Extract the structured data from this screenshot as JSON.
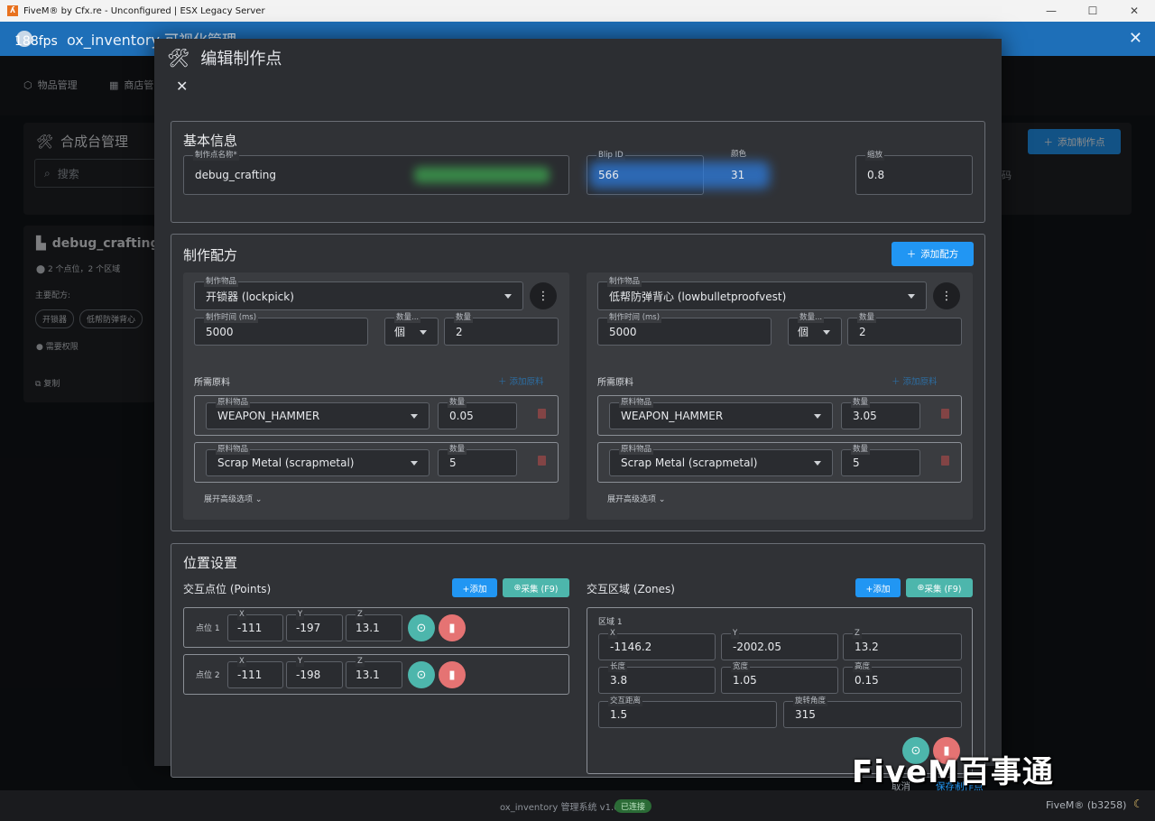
{
  "window": {
    "title": "FiveM® by Cfx.re - Unconfigured | ESX Legacy Server"
  },
  "app": {
    "title": "ox_inventory 可视化管理",
    "fps": "188fps"
  },
  "nav": {
    "items": [
      "物品管理",
      "商店管"
    ]
  },
  "background": {
    "panel_title": "合成台管理",
    "search_placeholder": "搜索",
    "add_button": "添加制作点",
    "hint_text": "码",
    "card": {
      "title": "debug_crafting",
      "meta": "2 个点位，2 个区域",
      "recipes_label": "主要配方:",
      "chips": [
        "开锁器",
        "低帮防弹背心"
      ],
      "permission": "需要权限",
      "copy": "复制"
    }
  },
  "modal": {
    "title": "编辑制作点",
    "basic": {
      "title": "基本信息",
      "name_label": "制作点名称*",
      "name_value": "debug_crafting",
      "blip_label": "Blip ID",
      "blip_value": "566",
      "color_label": "颜色",
      "color_value": "31",
      "scale_label": "缩放",
      "scale_value": "0.8"
    },
    "recipes": {
      "title": "制作配方",
      "add_button": "添加配方",
      "items": [
        {
          "item_label": "制作物品",
          "item_value": "开锁器 (lockpick)",
          "time_label": "制作时间 (ms)",
          "time_value": "5000",
          "unit_label": "数量...",
          "unit_value": "個",
          "count_label": "数量",
          "count_value": "2",
          "materials_label": "所需原料",
          "add_material": "添加原料",
          "materials": [
            {
              "label": "原料物品",
              "item": "WEAPON_HAMMER",
              "qty_label": "数量",
              "qty": "0.05"
            },
            {
              "label": "原料物品",
              "item": "Scrap Metal (scrapmetal)",
              "qty_label": "数量",
              "qty": "5"
            }
          ],
          "advanced": "展开高级选项"
        },
        {
          "item_label": "制作物品",
          "item_value": "低帮防弹背心 (lowbulletproofvest)",
          "time_label": "制作时间 (ms)",
          "time_value": "5000",
          "unit_label": "数量...",
          "unit_value": "個",
          "count_label": "数量",
          "count_value": "2",
          "materials_label": "所需原料",
          "add_material": "添加原料",
          "materials": [
            {
              "label": "原料物品",
              "item": "WEAPON_HAMMER",
              "qty_label": "数量",
              "qty": "3.05"
            },
            {
              "label": "原料物品",
              "item": "Scrap Metal (scrapmetal)",
              "qty_label": "数量",
              "qty": "5"
            }
          ],
          "advanced": "展开高级选项"
        }
      ]
    },
    "location": {
      "title": "位置设置",
      "points_title": "交互点位 (Points)",
      "zones_title": "交互区域 (Zones)",
      "add_button": "+添加",
      "capture_button": "采集 (F9)",
      "points": [
        {
          "label": "点位 1",
          "x": "-111",
          "y": "-197",
          "z": "13.1"
        },
        {
          "label": "点位 2",
          "x": "-111",
          "y": "-198",
          "z": "13.1"
        }
      ],
      "axis_labels": {
        "x": "X",
        "y": "Y",
        "z": "Z"
      },
      "zone": {
        "label": "区域 1",
        "x": "-1146.2",
        "y": "-2002.05",
        "z": "13.2",
        "length_label": "长度",
        "length": "3.8",
        "width_label": "宽度",
        "width": "1.05",
        "height_label": "高度",
        "height": "0.15",
        "distance_label": "交互距离",
        "distance": "1.5",
        "rotation_label": "旋转角度",
        "rotation": "315"
      }
    },
    "footer": {
      "cancel": "取消",
      "save": "保存制作点"
    }
  },
  "statusbar": {
    "text": "ox_inventory 管理系统 v1.0",
    "badge": "已连接",
    "build": "FiveM® (b3258)"
  },
  "watermark": "FiveM百事通",
  "colors": {
    "accent": "#2196f3",
    "teal": "#4db6ac",
    "danger": "#e57373",
    "appbar": "#1e6fb8"
  }
}
